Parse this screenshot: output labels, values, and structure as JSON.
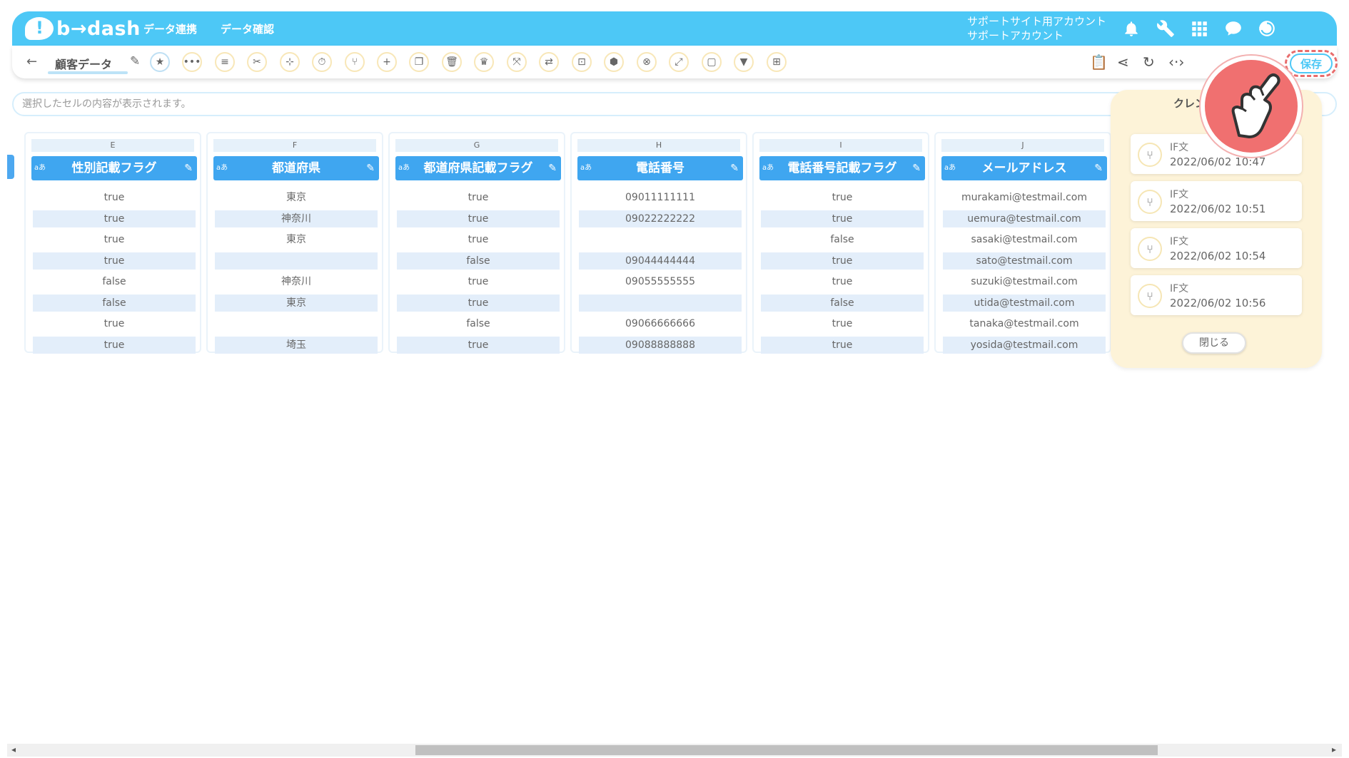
{
  "header": {
    "logo": "b→dash",
    "nav": [
      "データ連携",
      "データ確認"
    ],
    "account_line1": "サポートサイト用アカウント",
    "account_line2": "サポートアカウント",
    "icons": [
      "bell-icon",
      "wrench-icon",
      "grid-icon",
      "chat-icon",
      "logout-icon"
    ]
  },
  "toolbar": {
    "back": "←",
    "tab_name": "顧客データ",
    "edit": "✎",
    "tools": [
      "★",
      "•••",
      "≡",
      "✂",
      "⊹",
      "⏱",
      "⑂",
      "+",
      "❐",
      "🗑",
      "♛",
      "⤧",
      "⇄",
      "⊡",
      "⬢",
      "⊗",
      "⤢",
      "▢",
      "▼",
      "⊞"
    ],
    "right_icons": [
      "📋",
      "⋖",
      "↻",
      "‹·›"
    ],
    "save": "保存"
  },
  "cellbar": {
    "placeholder": "選択したセルの内容が表示されます。"
  },
  "grid": {
    "columns": [
      {
        "letter": "E",
        "type": "aあ",
        "name": "性別記載フラグ",
        "cells": [
          "true",
          "true",
          "true",
          "true",
          "false",
          "false",
          "true",
          "true"
        ]
      },
      {
        "letter": "F",
        "type": "aあ",
        "name": "都道府県",
        "cells": [
          "東京",
          "神奈川",
          "東京",
          "",
          "神奈川",
          "東京",
          "",
          "埼玉"
        ]
      },
      {
        "letter": "G",
        "type": "aあ",
        "name": "都道府県記載フラグ",
        "cells": [
          "true",
          "true",
          "true",
          "false",
          "true",
          "true",
          "false",
          "true"
        ]
      },
      {
        "letter": "H",
        "type": "aあ",
        "name": "電話番号",
        "cells": [
          "09011111111",
          "09022222222",
          "",
          "09044444444",
          "09055555555",
          "",
          "09066666666",
          "09088888888"
        ]
      },
      {
        "letter": "I",
        "type": "aあ",
        "name": "電話番号記載フラグ",
        "cells": [
          "true",
          "true",
          "false",
          "true",
          "true",
          "false",
          "true",
          "true"
        ]
      },
      {
        "letter": "J",
        "type": "aあ",
        "name": "メールアドレス",
        "cells": [
          "murakami@testmail.com",
          "uemura@testmail.com",
          "sasaki@testmail.com",
          "sato@testmail.com",
          "suzuki@testmail.com",
          "utida@testmail.com",
          "tanaka@testmail.com",
          "yosida@testmail.com"
        ]
      }
    ]
  },
  "history": {
    "title": "クレン",
    "items": [
      {
        "type": "IF文",
        "date": "2022/06/02 10:47"
      },
      {
        "type": "IF文",
        "date": "2022/06/02 10:51"
      },
      {
        "type": "IF文",
        "date": "2022/06/02 10:54"
      },
      {
        "type": "IF文",
        "date": "2022/06/02 10:56"
      }
    ],
    "close": "閉じる"
  },
  "colors": {
    "header": "#4dc8f6",
    "column_header": "#3fa6f0",
    "panel": "#fdf3d8",
    "highlight": "#e86c6c"
  }
}
